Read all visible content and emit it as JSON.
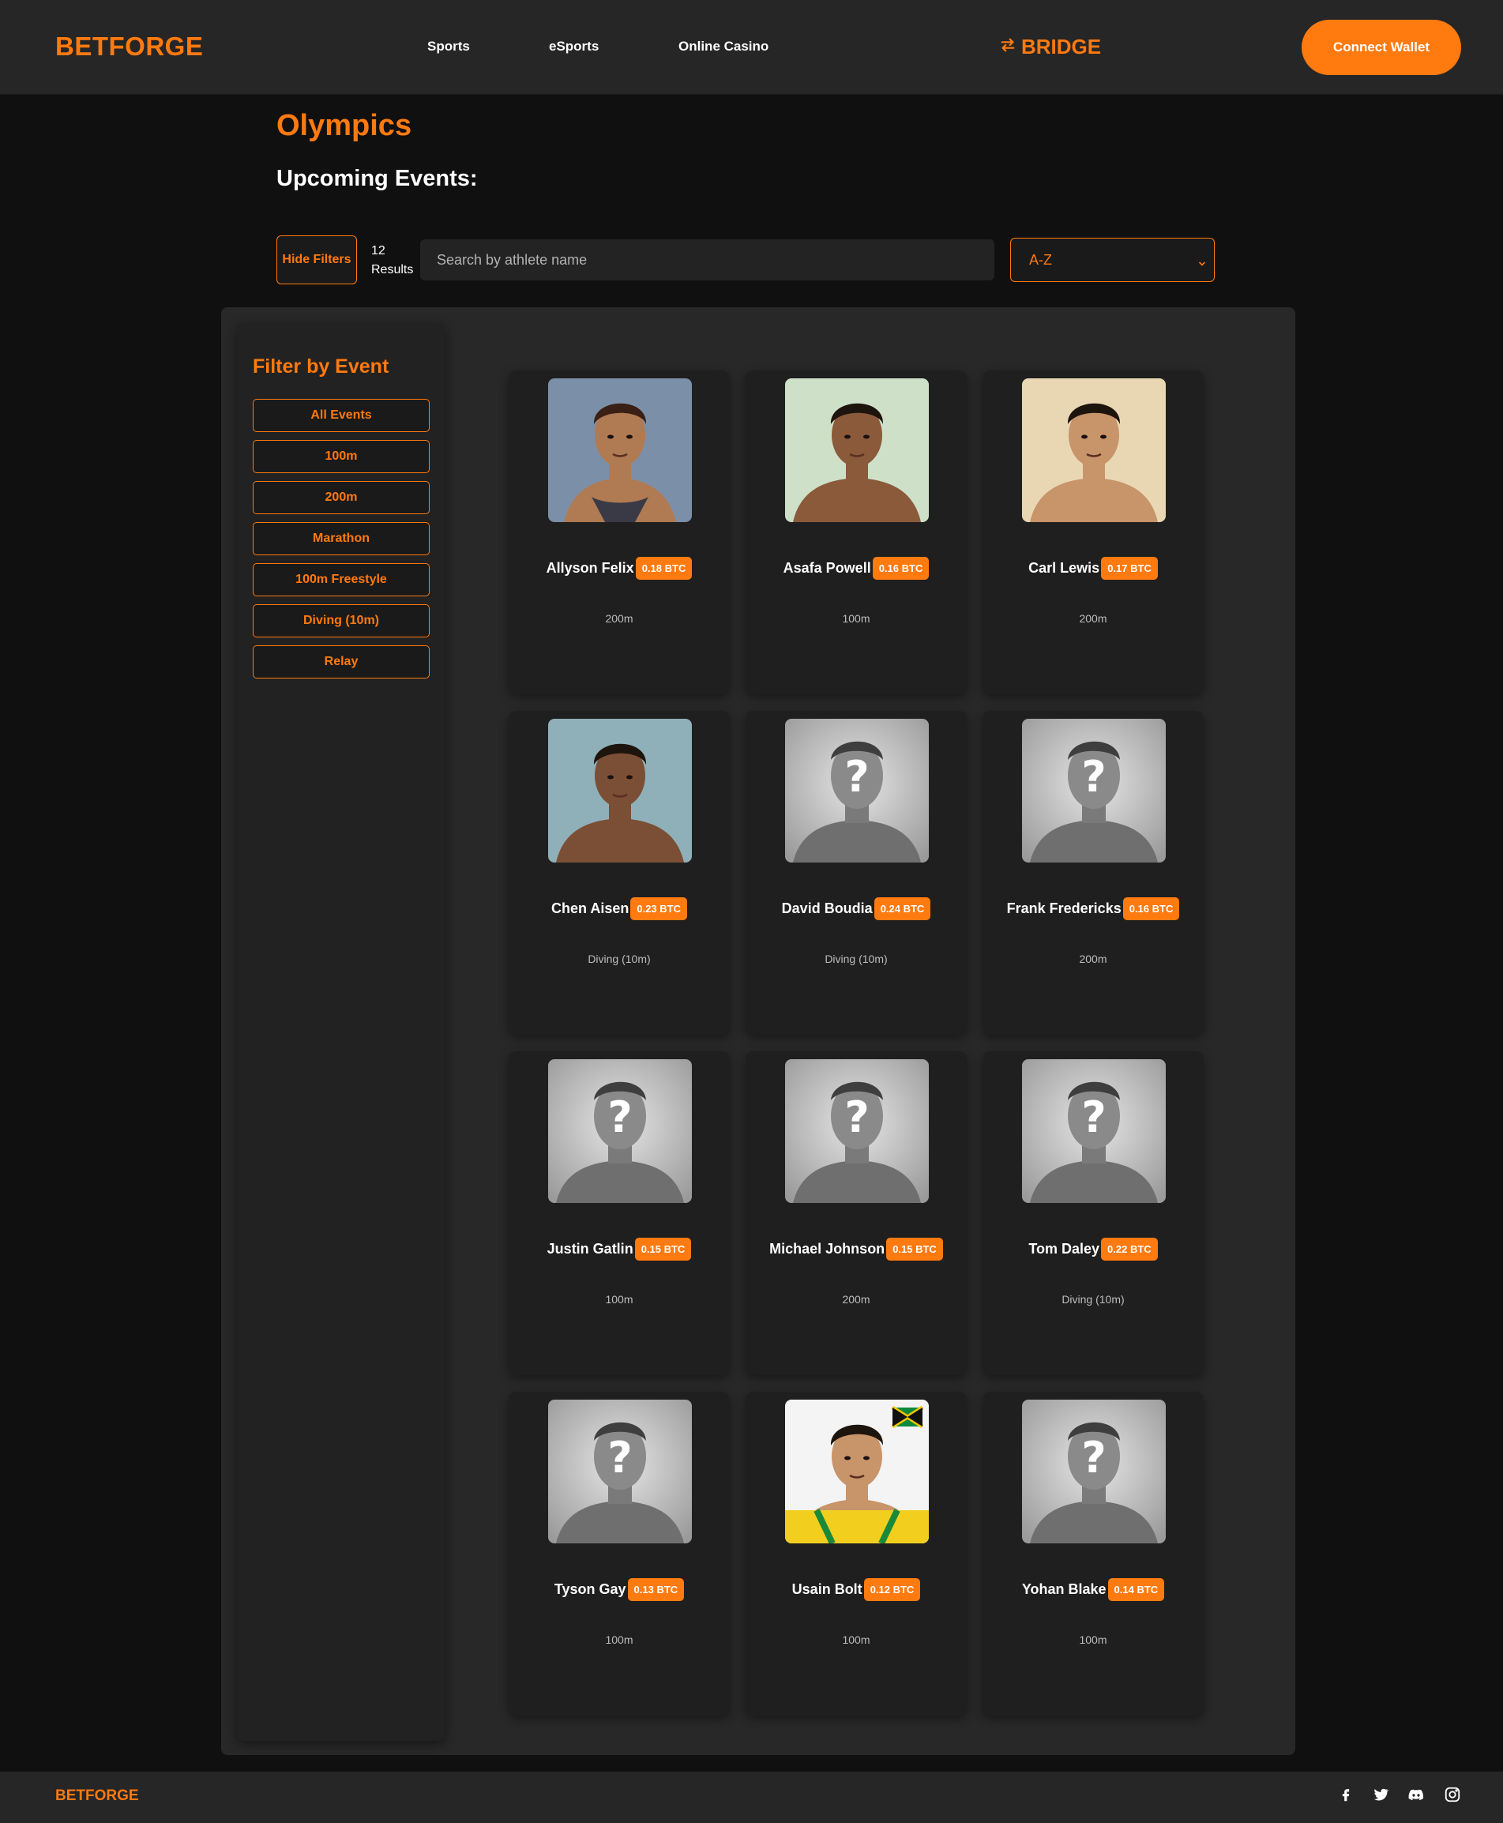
{
  "header": {
    "logo": "BETFORGE",
    "nav": [
      "Sports",
      "eSports",
      "Online Casino"
    ],
    "bridge_label": "BRIDGE",
    "connect_wallet_label": "Connect Wallet"
  },
  "page": {
    "title": "Olympics",
    "section_title": "Upcoming Events:"
  },
  "toolbar": {
    "hide_filters_label": "Hide Filters",
    "results_count": "12",
    "results_label": "Results",
    "search_placeholder": "Search by athlete name",
    "sort_value": "A-Z"
  },
  "sidebar": {
    "title": "Filter by Event",
    "filters": [
      "All Events",
      "100m",
      "200m",
      "Marathon",
      "100m Freestyle",
      "Diving (10m)",
      "Relay"
    ]
  },
  "athletes": [
    {
      "name": "Allyson Felix",
      "price": "0.18 BTC",
      "event": "200m",
      "avatar": "portrait-female"
    },
    {
      "name": "Asafa Powell",
      "price": "0.16 BTC",
      "event": "100m",
      "avatar": "portrait-illustrated"
    },
    {
      "name": "Carl Lewis",
      "price": "0.17 BTC",
      "event": "200m",
      "avatar": "portrait"
    },
    {
      "name": "Chen Aisen",
      "price": "0.23 BTC",
      "event": "Diving (10m)",
      "avatar": "portrait"
    },
    {
      "name": "David Boudia",
      "price": "0.24 BTC",
      "event": "Diving (10m)",
      "avatar": "placeholder"
    },
    {
      "name": "Frank Fredericks",
      "price": "0.16 BTC",
      "event": "200m",
      "avatar": "placeholder"
    },
    {
      "name": "Justin Gatlin",
      "price": "0.15 BTC",
      "event": "100m",
      "avatar": "placeholder"
    },
    {
      "name": "Michael Johnson",
      "price": "0.15 BTC",
      "event": "200m",
      "avatar": "placeholder"
    },
    {
      "name": "Tom Daley",
      "price": "0.22 BTC",
      "event": "Diving (10m)",
      "avatar": "placeholder"
    },
    {
      "name": "Tyson Gay",
      "price": "0.13 BTC",
      "event": "100m",
      "avatar": "placeholder"
    },
    {
      "name": "Usain Bolt",
      "price": "0.12 BTC",
      "event": "100m",
      "avatar": "portrait-flag"
    },
    {
      "name": "Yohan Blake",
      "price": "0.14 BTC",
      "event": "100m",
      "avatar": "placeholder"
    }
  ],
  "footer": {
    "logo": "BETFORGE",
    "social_icons": [
      "facebook-icon",
      "twitter-icon",
      "discord-icon",
      "instagram-icon"
    ]
  },
  "colors": {
    "accent": "#ff7a0f",
    "background": "#101010",
    "header": "#262626",
    "panel": "#282828",
    "card": "#1f1f1f"
  }
}
